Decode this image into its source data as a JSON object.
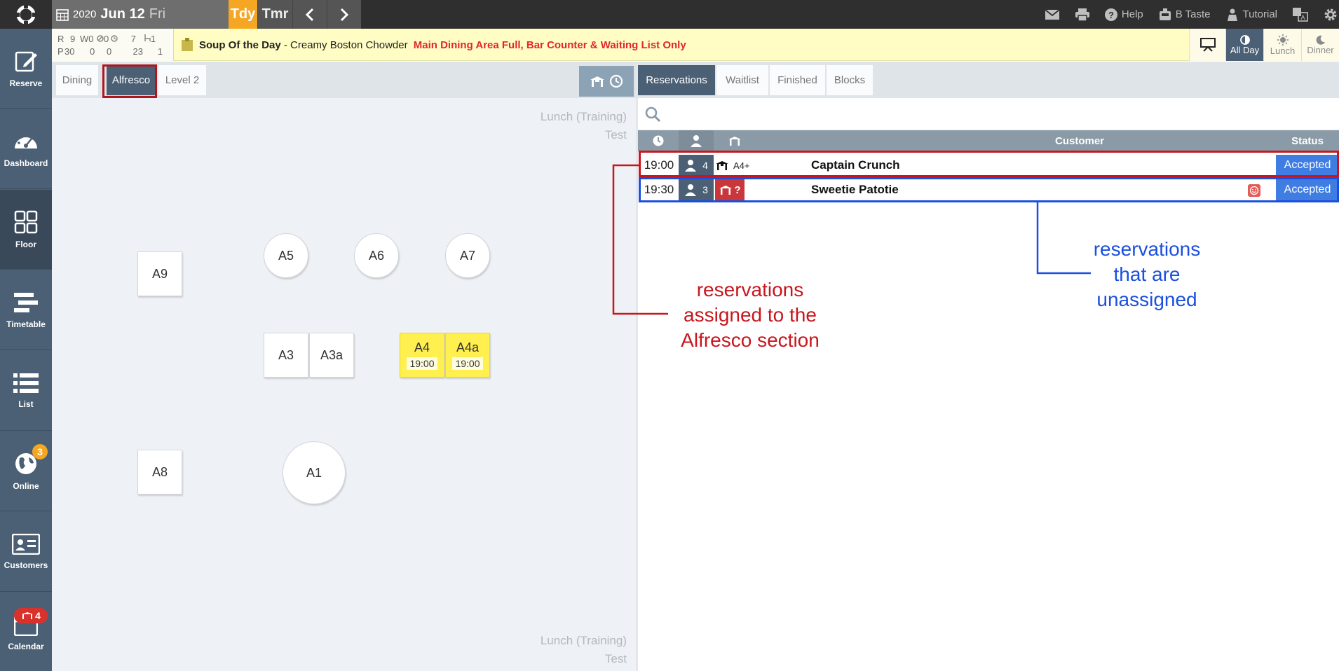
{
  "topbar": {
    "year": "2020",
    "month_day": "Jun 12",
    "weekday": "Fri",
    "today_label": "Tdy",
    "tomorrow_label": "Tmr",
    "links": [
      "Help",
      "B Taste",
      "Tutorial"
    ]
  },
  "sidebar": {
    "items": [
      {
        "label": "Reserve",
        "icon": "edit-icon"
      },
      {
        "label": "Dashboard",
        "icon": "gauge-icon"
      },
      {
        "label": "Floor",
        "icon": "grid-icon"
      },
      {
        "label": "Timetable",
        "icon": "timetable-icon"
      },
      {
        "label": "List",
        "icon": "list-icon"
      },
      {
        "label": "Online",
        "icon": "globe-icon",
        "badge": "3"
      },
      {
        "label": "Customers",
        "icon": "id-card-icon"
      },
      {
        "label": "Calendar",
        "icon": "calendar-icon",
        "badge": "4"
      }
    ]
  },
  "stats": {
    "r_label": "R",
    "r_vals": [
      "9",
      "W0",
      "0",
      "7",
      "1"
    ],
    "p_label": "P",
    "p_vals": [
      "30",
      "0",
      "0",
      "23",
      "1"
    ]
  },
  "notice": {
    "soup_label": "Soup Of the Day",
    "soup_text": " - Creamy Boston Chowder ",
    "alert": "Main Dining Area Full, Bar Counter & Waiting List Only"
  },
  "services": [
    {
      "label": "All Day",
      "active": true
    },
    {
      "label": "Lunch",
      "active": false
    },
    {
      "label": "Dinner",
      "active": false
    }
  ],
  "floor": {
    "tabs": [
      "Dining",
      "Alfresco",
      "Level 2"
    ],
    "selected_tab": "Alfresco",
    "corner_note_line1": "Lunch (Training)",
    "corner_note_line2": "Test",
    "tables": [
      {
        "name": "A9",
        "shape": "square"
      },
      {
        "name": "A5",
        "shape": "round"
      },
      {
        "name": "A6",
        "shape": "round"
      },
      {
        "name": "A7",
        "shape": "round"
      },
      {
        "name": "A3",
        "shape": "square"
      },
      {
        "name": "A3a",
        "shape": "square"
      },
      {
        "name": "A4",
        "shape": "square",
        "time": "19:00",
        "occupied": true
      },
      {
        "name": "A4a",
        "shape": "square",
        "time": "19:00",
        "occupied": true
      },
      {
        "name": "A8",
        "shape": "square"
      },
      {
        "name": "A1",
        "shape": "round"
      }
    ]
  },
  "reservations_panel": {
    "tabs": [
      "Reservations",
      "Waitlist",
      "Finished",
      "Blocks"
    ],
    "selected_tab": "Reservations",
    "columns": {
      "customer": "Customer",
      "status": "Status"
    },
    "rows": [
      {
        "time": "19:00",
        "party": "4",
        "table": "A4+",
        "name": "Captain Crunch",
        "status": "Accepted",
        "assigned": true
      },
      {
        "time": "19:30",
        "party": "3",
        "table": "?",
        "name": "Sweetie Patotie",
        "status": "Accepted",
        "assigned": false
      }
    ]
  },
  "annotations": {
    "assigned": [
      "reservations",
      "assigned to the",
      "Alfresco section"
    ],
    "unassigned": [
      "reservations",
      "that are",
      "unassigned"
    ],
    "assigned_color": "#c8161d",
    "unassigned_color": "#1a4fe0"
  }
}
